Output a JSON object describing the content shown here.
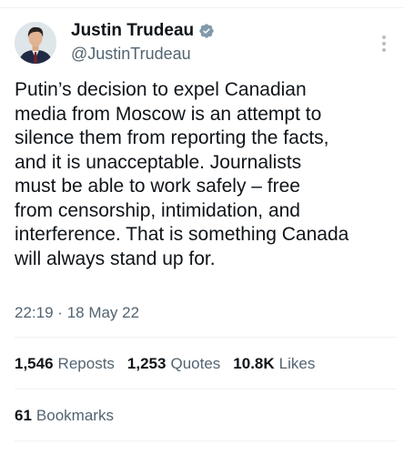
{
  "author": {
    "display_name": "Justin Trudeau",
    "handle": "@JustinTrudeau",
    "verified": true,
    "verified_color": "#829aab"
  },
  "tweet": {
    "lines": [
      "Putin’s decision to expel Canadian",
      "media from Moscow is an attempt to",
      "silence them from reporting the facts,",
      "and it is unacceptable. Journalists",
      "must be able to work safely – free",
      "from censorship, intimidation, and",
      "interference. That is something Canada",
      "will always stand up for."
    ],
    "time": "22:19",
    "separator": "·",
    "date": "18 May 22"
  },
  "stats": {
    "reposts_count": "1,546",
    "reposts_label": "Reposts",
    "quotes_count": "1,253",
    "quotes_label": "Quotes",
    "likes_count": "10.8K",
    "likes_label": "Likes",
    "bookmarks_count": "61",
    "bookmarks_label": "Bookmarks"
  },
  "colors": {
    "text_primary": "#0f1419",
    "text_secondary": "#536471",
    "divider": "#eff3f4"
  },
  "icons": {
    "more": "more-vertical-icon",
    "verified": "verified-badge-icon"
  }
}
